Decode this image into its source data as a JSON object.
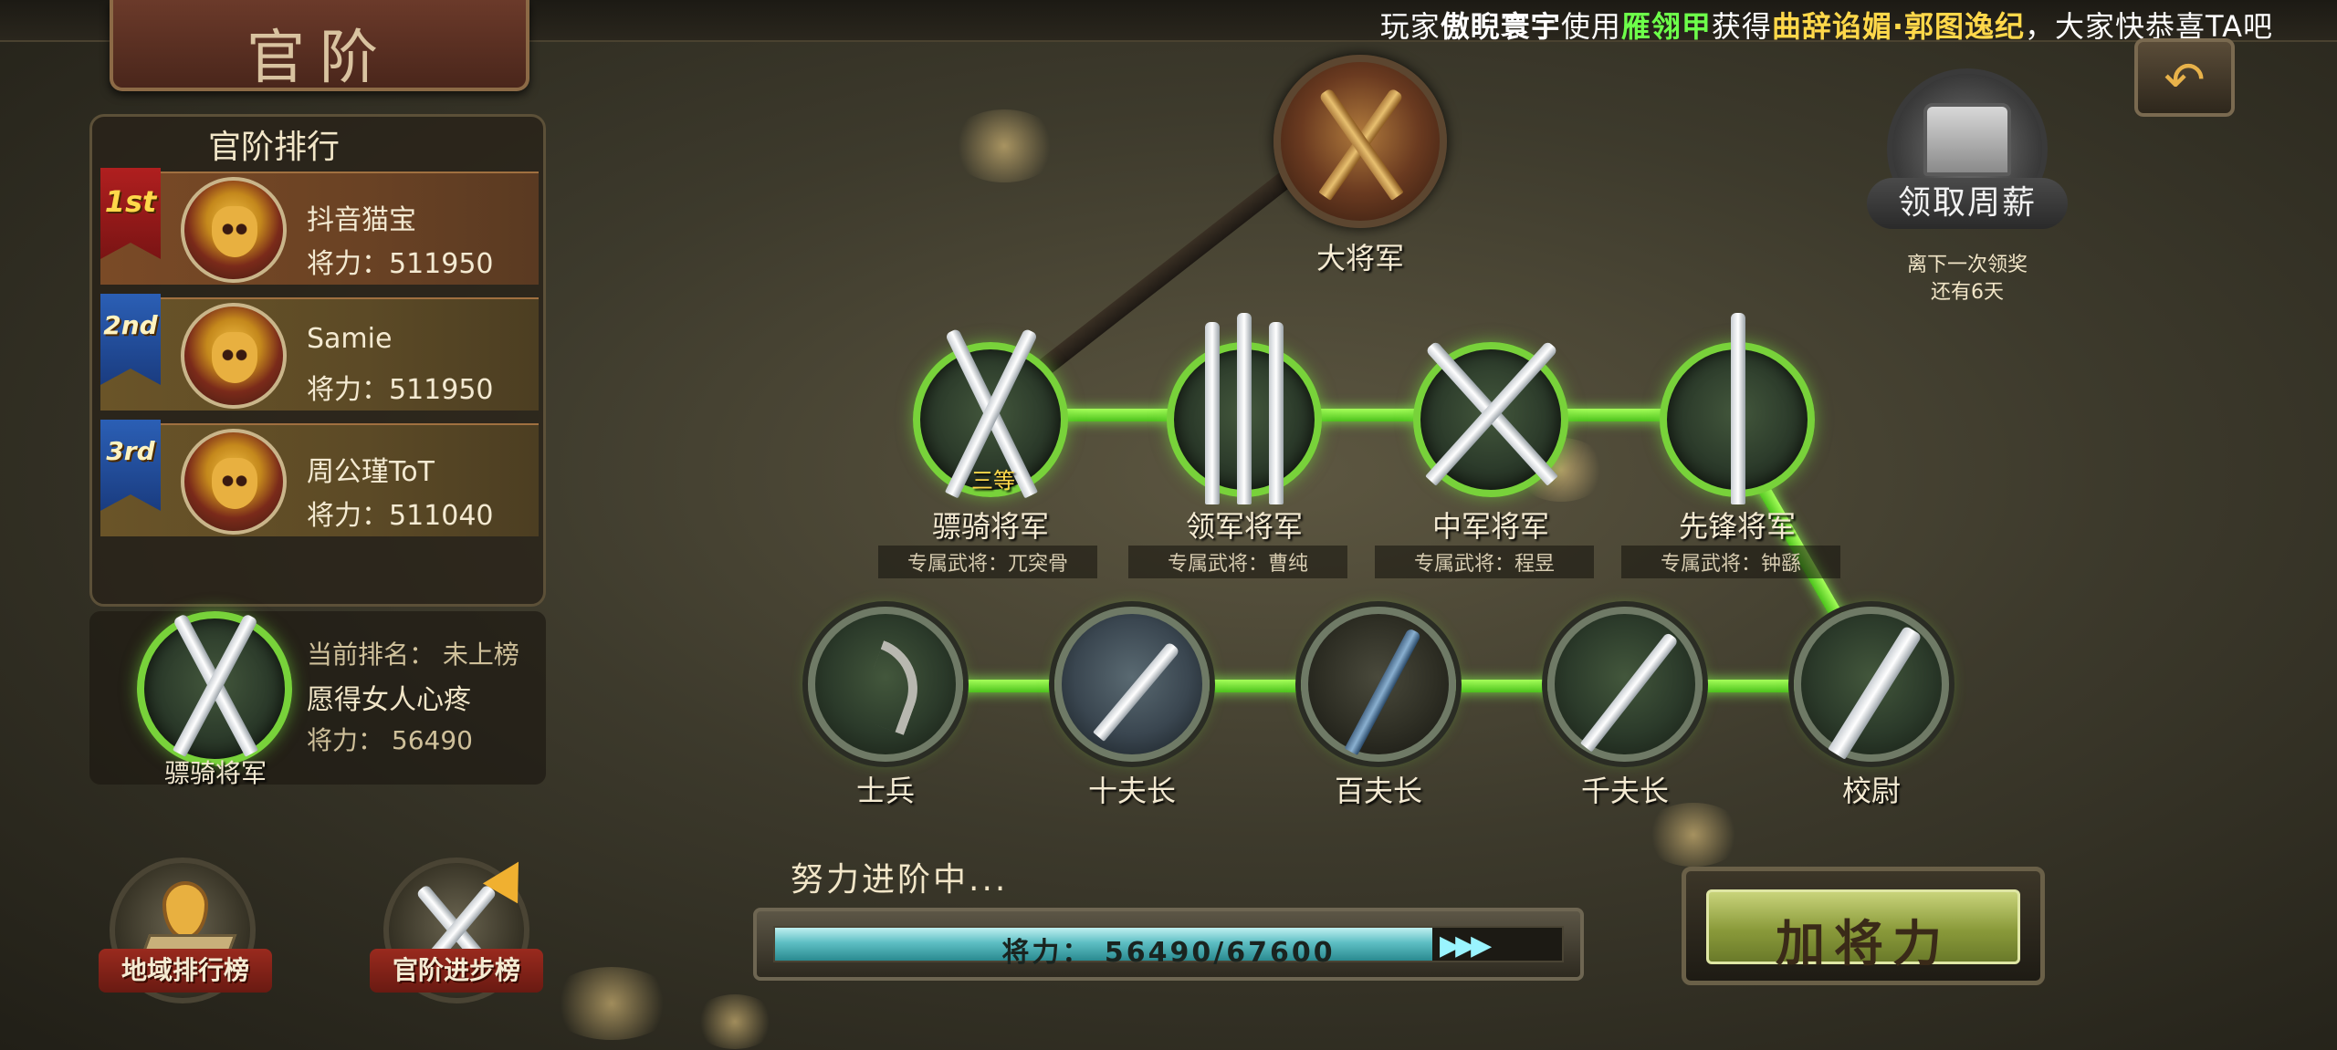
{
  "ticker": {
    "prefix": "玩家",
    "player": "傲睨寰宇",
    "used": "使用",
    "item": "雁翎甲",
    "got": "获得",
    "reward": "曲辞谄媚·郭图逸纪",
    "suffix": "，大家快恭喜TA吧"
  },
  "title": "官阶",
  "ranking": {
    "heading": "官阶排行",
    "entries": [
      {
        "badge": "1st",
        "name": "抖音猫宝",
        "power": "将力：511950"
      },
      {
        "badge": "2nd",
        "name": "Samie",
        "power": "将力：511950"
      },
      {
        "badge": "3rd",
        "name": "周公瑾ToT",
        "power": "将力：511040"
      }
    ],
    "me": {
      "rank_text": "当前排名：  未上榜",
      "name": "愿得女人心疼",
      "power": "将力：  56490",
      "title_label": "骠骑将军"
    }
  },
  "tree": {
    "top": {
      "label": "大将军"
    },
    "generals": [
      {
        "label": "骠骑将军",
        "exclusive": "专属武将：兀突骨",
        "grade": "三等"
      },
      {
        "label": "领军将军",
        "exclusive": "专属武将：曹纯"
      },
      {
        "label": "中军将军",
        "exclusive": "专属武将：程昱"
      },
      {
        "label": "先锋将军",
        "exclusive": "专属武将：钟繇"
      }
    ],
    "ranks": [
      {
        "label": "士兵"
      },
      {
        "label": "十夫长"
      },
      {
        "label": "百夫长"
      },
      {
        "label": "千夫长"
      },
      {
        "label": "校尉"
      }
    ]
  },
  "weekly": {
    "label": "领取周薪",
    "note_line1": "离下一次领奖",
    "note_line2": "还有6天"
  },
  "back_glyph": "↶",
  "progress": {
    "caption": "努力进阶中...",
    "text": "将力： 56490/67600",
    "current": 56490,
    "target": 67600,
    "arrows": "▶▶▶"
  },
  "add_power": "加将力",
  "bottom_buttons": {
    "region_rank": "地域排行榜",
    "promotion": "官阶进步榜"
  },
  "colors": {
    "link_green": "#78d23a",
    "progress_cyan": "#5ebfc4",
    "rank1_ribbon": "#b01f1f",
    "rank_ribbon": "#2b5fb5"
  }
}
